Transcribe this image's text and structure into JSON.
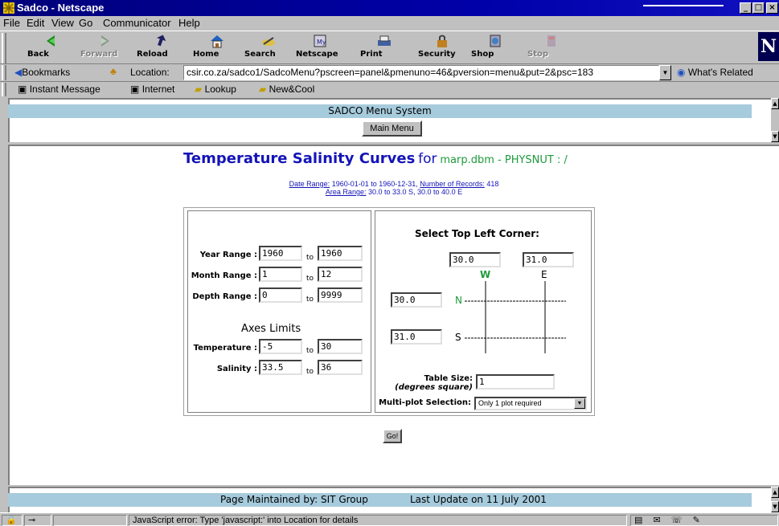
{
  "window": {
    "title": "Sadco - Netscape",
    "minimize": "_",
    "maximize": "□",
    "close": "×"
  },
  "menu": [
    "File",
    "Edit",
    "View",
    "Go",
    "Communicator",
    "Help"
  ],
  "toolbar": {
    "buttons": [
      {
        "label": "Back",
        "icon": "back-arrow-icon"
      },
      {
        "label": "Forward",
        "icon": "forward-arrow-icon"
      },
      {
        "label": "Reload",
        "icon": "reload-icon"
      },
      {
        "label": "Home",
        "icon": "home-icon"
      },
      {
        "label": "Search",
        "icon": "search-icon"
      },
      {
        "label": "Netscape",
        "icon": "netscape-icon"
      },
      {
        "label": "Print",
        "icon": "print-icon"
      },
      {
        "label": "Security",
        "icon": "lock-icon"
      },
      {
        "label": "Shop",
        "icon": "shop-icon"
      },
      {
        "label": "Stop",
        "icon": "stop-icon"
      }
    ],
    "logo": "N"
  },
  "location": {
    "bookmarks_label": "Bookmarks",
    "label": "Location:",
    "url": "csir.co.za/sadco1/SadcoMenu?pscreen=panel&pmenuno=46&pversion=menu&put=2&psc=183",
    "whats_related": "What's Related"
  },
  "personal_toolbar": [
    "Instant Message",
    "Internet",
    "Lookup",
    "New&Cool"
  ],
  "top_frame": {
    "title": "SADCO Menu System",
    "main_menu_button": "Main Menu"
  },
  "main": {
    "heading_bold": "Temperature Salinity Curves",
    "heading_for": "for",
    "heading_source": "marp.dbm - PHYSNUT : /",
    "date_range_label": "Date Range:",
    "date_range_value": "1960-01-01 to 1960-12-31,",
    "records_label": "Number of Records:",
    "records_value": "418",
    "area_range_label": "Area Range:",
    "area_range_value": "30.0 to 33.0 S, 30.0 to 40.0 E",
    "to": "to",
    "year_range": {
      "label": "Year Range :",
      "from": "1960",
      "to": "1960"
    },
    "month_range": {
      "label": "Month Range :",
      "from": "1",
      "to": "12"
    },
    "depth_range": {
      "label": "Depth Range :",
      "from": "0",
      "to": "9999"
    },
    "axes_title": "Axes Limits",
    "temperature": {
      "label": "Temperature :",
      "from": "-5",
      "to": "30"
    },
    "salinity": {
      "label": "Salinity :",
      "from": "33.5",
      "to": "36"
    },
    "corner_title": "Select Top Left Corner:",
    "west_value": "30.0",
    "east_value": "31.0",
    "north_value": "30.0",
    "south_value": "31.0",
    "w": "W",
    "e": "E",
    "n": "N",
    "s": "S",
    "table_size_label": "Table Size:",
    "table_size_sub": "(degrees square)",
    "table_size_value": "1",
    "multiplot_label": "Multi-plot Selection:",
    "multiplot_value": "Only 1 plot required",
    "go_button": "Go!"
  },
  "footer": {
    "maintained": "Page Maintained by: SIT Group",
    "updated": "Last Update on 11 July 2001"
  },
  "status": {
    "message": "JavaScript error: Type 'javascript:' into Location for details"
  },
  "colors": {
    "title_bar": "#0000a8",
    "band": "#a6cbdc",
    "heading": "#1414b8",
    "source": "#1e9a3c",
    "n_label": "#1e9a3c"
  }
}
